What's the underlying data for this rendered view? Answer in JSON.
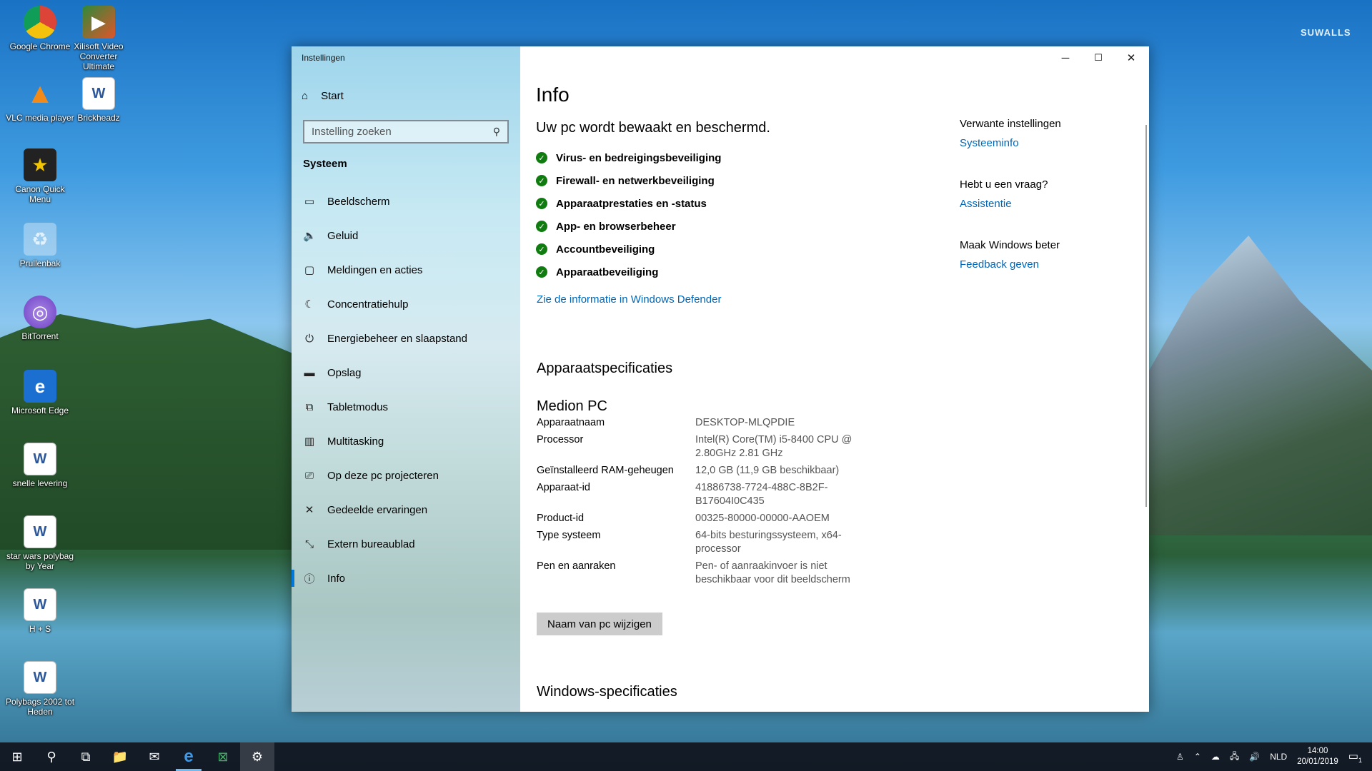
{
  "wallpaper": {
    "brand": "SUWALLS"
  },
  "desktop_icons": [
    {
      "label": "Google Chrome",
      "icon": "chrome-icon"
    },
    {
      "label": "Xilisoft Video Converter Ultimate",
      "icon": "video-converter-icon"
    },
    {
      "label": "VLC media player",
      "icon": "vlc-icon"
    },
    {
      "label": "Brickheadz",
      "icon": "word-document-icon"
    },
    {
      "label": "Canon Quick Menu",
      "icon": "canon-icon"
    },
    {
      "label": "Prullenbak",
      "icon": "recycle-bin-icon"
    },
    {
      "label": "BitTorrent",
      "icon": "bittorrent-icon"
    },
    {
      "label": "Microsoft Edge",
      "icon": "edge-icon"
    },
    {
      "label": "snelle levering",
      "icon": "word-document-icon"
    },
    {
      "label": "star wars polybag by Year",
      "icon": "word-document-icon"
    },
    {
      "label": "H + S",
      "icon": "word-document-icon"
    },
    {
      "label": "Polybags 2002 tot Heden",
      "icon": "word-document-icon"
    }
  ],
  "window": {
    "title": "Instellingen",
    "controls": {
      "minimize": "─",
      "maximize": "☐",
      "close": "✕"
    }
  },
  "sidebar": {
    "home_label": "Start",
    "search_placeholder": "Instelling zoeken",
    "section": "Systeem",
    "items": [
      {
        "label": "Beeldscherm",
        "icon": "monitor-icon",
        "glyph": "▭"
      },
      {
        "label": "Geluid",
        "icon": "speaker-icon",
        "glyph": "🔈"
      },
      {
        "label": "Meldingen en acties",
        "icon": "notification-icon",
        "glyph": "▢"
      },
      {
        "label": "Concentratiehulp",
        "icon": "moon-icon",
        "glyph": "☾"
      },
      {
        "label": "Energiebeheer en slaapstand",
        "icon": "power-icon",
        "glyph": "⏻"
      },
      {
        "label": "Opslag",
        "icon": "storage-icon",
        "glyph": "▬"
      },
      {
        "label": "Tabletmodus",
        "icon": "tablet-icon",
        "glyph": "⧉"
      },
      {
        "label": "Multitasking",
        "icon": "multitasking-icon",
        "glyph": "▥"
      },
      {
        "label": "Op deze pc projecteren",
        "icon": "project-icon",
        "glyph": "⎚"
      },
      {
        "label": "Gedeelde ervaringen",
        "icon": "shared-icon",
        "glyph": "✕"
      },
      {
        "label": "Extern bureaublad",
        "icon": "remote-icon",
        "glyph": "⤡"
      },
      {
        "label": "Info",
        "icon": "info-icon",
        "glyph": "ⓘ",
        "active": true
      }
    ]
  },
  "main": {
    "title": "Info",
    "protection_heading": "Uw pc wordt bewaakt en beschermd.",
    "protection_items": [
      "Virus- en bedreigingsbeveiliging",
      "Firewall- en netwerkbeveiliging",
      "Apparaatprestaties en -status",
      "App- en browserbeheer",
      "Accountbeveiliging",
      "Apparaatbeveiliging"
    ],
    "defender_link": "Zie de informatie in Windows Defender",
    "specs_heading": "Apparaatspecificaties",
    "device_brand": "Medion PC",
    "specs": [
      {
        "label": "Apparaatnaam",
        "value": "DESKTOP-MLQPDIE"
      },
      {
        "label": "Processor",
        "value": "Intel(R) Core(TM) i5-8400 CPU @ 2.80GHz   2.81 GHz"
      },
      {
        "label": "Geïnstalleerd RAM-geheugen",
        "value": "12,0 GB (11,9 GB beschikbaar)"
      },
      {
        "label": "Apparaat-id",
        "value": "41886738-7724-488C-8B2F-B17604I0C435"
      },
      {
        "label": "Product-id",
        "value": "00325-80000-00000-AAOEM"
      },
      {
        "label": "Type systeem",
        "value": "64-bits besturingssysteem, x64-processor"
      },
      {
        "label": "Pen en aanraken",
        "value": "Pen- of aanraakinvoer is niet beschikbaar voor dit beeldscherm"
      }
    ],
    "rename_button": "Naam van pc wijzigen",
    "windows_specs_heading": "Windows-specificaties"
  },
  "related": {
    "blocks": [
      {
        "title": "Verwante instellingen",
        "link": "Systeeminfo"
      },
      {
        "title": "Hebt u een vraag?",
        "link": "Assistentie"
      },
      {
        "title": "Maak Windows beter",
        "link": "Feedback geven"
      }
    ]
  },
  "taskbar": {
    "apps": [
      {
        "icon": "windows-start-icon",
        "glyph": "⊞"
      },
      {
        "icon": "search-icon",
        "glyph": "⚲"
      },
      {
        "icon": "task-view-icon",
        "glyph": "⧉"
      },
      {
        "icon": "file-explorer-icon",
        "glyph": "📁"
      },
      {
        "icon": "mail-icon",
        "glyph": "✉"
      },
      {
        "icon": "edge-icon",
        "glyph": "e",
        "running": true
      },
      {
        "icon": "excel-icon",
        "glyph": "⊠"
      },
      {
        "icon": "settings-icon",
        "glyph": "⚙",
        "active": true
      }
    ],
    "tray": {
      "language": "NLD",
      "time": "14:00",
      "date": "20/01/2019",
      "notification_count": "1"
    }
  }
}
